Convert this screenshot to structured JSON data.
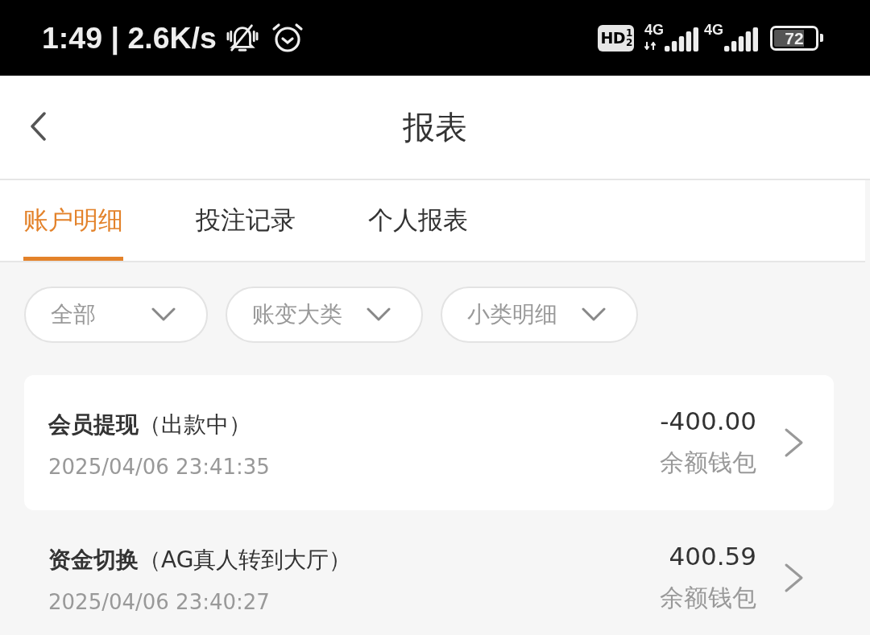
{
  "status_bar": {
    "clock_text": "1:49 | 2.6K/s",
    "hd_label": "HD",
    "sim_numbers": [
      "1",
      "2"
    ],
    "networks": [
      {
        "label": "4G",
        "data_arrows": true
      },
      {
        "label": "4G",
        "data_arrows": false
      }
    ],
    "battery_text": "72"
  },
  "header": {
    "title": "报表"
  },
  "tabs": [
    {
      "label": "账户明细",
      "selected": true
    },
    {
      "label": "投注记录",
      "selected": false
    },
    {
      "label": "个人报表",
      "selected": false
    }
  ],
  "filters": [
    {
      "label": "全部"
    },
    {
      "label": "账变大类"
    },
    {
      "label": "小类明细"
    }
  ],
  "records": [
    {
      "title": "**会员提现**（出款中）",
      "time": "2025/04/06 23:41:35",
      "amount": "-400.00",
      "wallet": "余额钱包"
    },
    {
      "title": "**资金切换**（AG真人转到大厅）",
      "time": "2025/04/06 23:40:27",
      "amount": "400.59",
      "wallet": "余额钱包"
    }
  ]
}
